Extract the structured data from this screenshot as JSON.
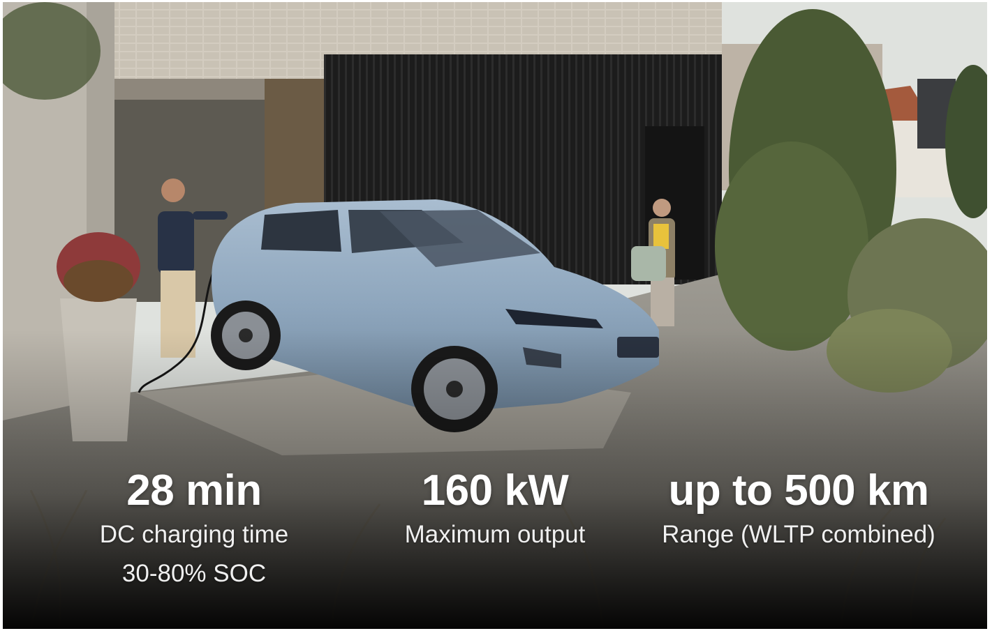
{
  "stats": [
    {
      "value": "28 min",
      "label_line1": "DC charging time",
      "label_line2": "30-80% SOC"
    },
    {
      "value": "160 kW",
      "label_line1": "Maximum output"
    },
    {
      "value": "up to 500 km",
      "label_line1": "Range (WLTP combined)"
    }
  ],
  "colors": {
    "text": "#ffffff",
    "car_body": "#8fa8c0",
    "facade_dark": "#1f1f1f",
    "brick": "#cfc8bc",
    "concrete": "#b9b4ab",
    "foliage": "#4f5f38",
    "sky": "#dde0dc"
  }
}
